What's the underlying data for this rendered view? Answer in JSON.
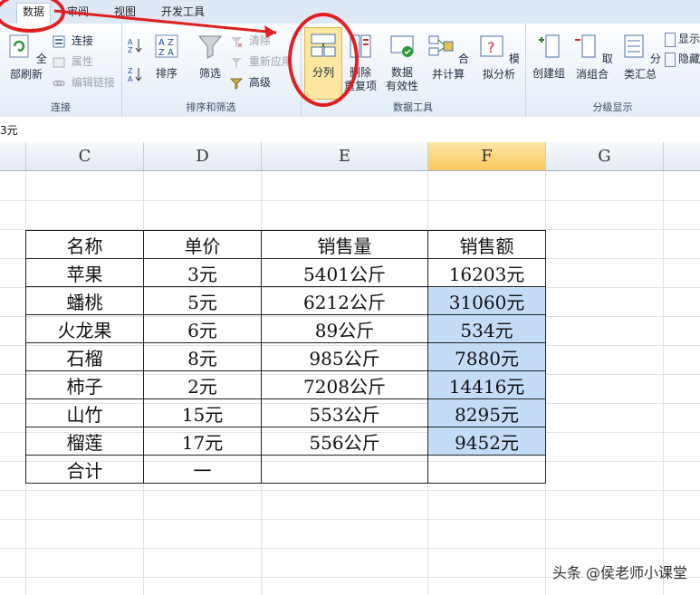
{
  "menu": {
    "tabs": [
      {
        "label": "数据",
        "active": true
      },
      {
        "label": "审阅",
        "active": false
      },
      {
        "label": "视图",
        "active": false
      },
      {
        "label": "开发工具",
        "active": false
      }
    ]
  },
  "ribbon": {
    "connect_group": {
      "label": "连接",
      "refresh_all": "全部刷新",
      "connect": "连接",
      "properties": "属性",
      "edit_links": "编辑链接"
    },
    "sort_filter_group": {
      "label": "排序和筛选",
      "sort": "排序",
      "filter": "筛选",
      "clear": "清除",
      "reapply": "重新应用",
      "advanced": "高级"
    },
    "data_tools_group": {
      "label": "数据工具",
      "text_to_columns": "分列",
      "remove_duplicates_1": "删除",
      "remove_duplicates_2": "重复项",
      "data_validation_1": "数据",
      "data_validation_2": "有效性",
      "consolidate": "合并计算",
      "what_if": "模拟分析"
    },
    "outline_group": {
      "label": "分级显示",
      "group": "创建组",
      "ungroup": "取消组合",
      "subtotal": "分类汇总",
      "show": "显示",
      "hide": "隐藏"
    }
  },
  "formula_bar": {
    "value": "3元"
  },
  "columns": [
    "C",
    "D",
    "E",
    "F",
    "G"
  ],
  "table": {
    "headers": [
      "名称",
      "单价",
      "销售量",
      "销售额"
    ],
    "rows": [
      [
        "苹果",
        "3元",
        "5401公斤",
        "16203元"
      ],
      [
        "蟠桃",
        "5元",
        "6212公斤",
        "31060元"
      ],
      [
        "火龙果",
        "6元",
        "89公斤",
        "534元"
      ],
      [
        "石榴",
        "8元",
        "985公斤",
        "7880元"
      ],
      [
        "柿子",
        "2元",
        "7208公斤",
        "14416元"
      ],
      [
        "山竹",
        "15元",
        "553公斤",
        "8295元"
      ],
      [
        "榴莲",
        "17元",
        "556公斤",
        "9452元"
      ]
    ],
    "total": [
      "合计",
      "一",
      "",
      ""
    ]
  },
  "watermark": "头条 @侯老师小课堂",
  "colors": {
    "selection": "#c5dcf7",
    "annotation": "#e02020"
  }
}
